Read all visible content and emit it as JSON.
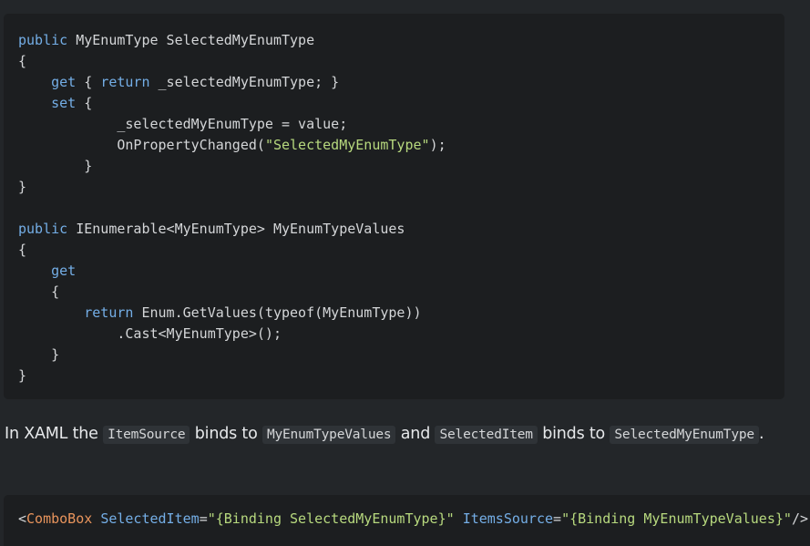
{
  "code1": {
    "lines": [
      [
        {
          "t": "public",
          "c": "kw"
        },
        {
          "t": " MyEnumType SelectedMyEnumType"
        }
      ],
      [
        {
          "t": "{"
        }
      ],
      [
        {
          "t": "    "
        },
        {
          "t": "get",
          "c": "kw"
        },
        {
          "t": " { "
        },
        {
          "t": "return",
          "c": "kw"
        },
        {
          "t": " _selectedMyEnumType; }"
        }
      ],
      [
        {
          "t": "    "
        },
        {
          "t": "set",
          "c": "kw"
        },
        {
          "t": " {"
        }
      ],
      [
        {
          "t": "            _selectedMyEnumType = value;"
        }
      ],
      [
        {
          "t": "            OnPropertyChanged("
        },
        {
          "t": "\"SelectedMyEnumType\"",
          "c": "str"
        },
        {
          "t": ");"
        }
      ],
      [
        {
          "t": "        }"
        }
      ],
      [
        {
          "t": "}"
        }
      ],
      [
        {
          "t": ""
        }
      ],
      [
        {
          "t": "public",
          "c": "kw"
        },
        {
          "t": " IEnumerable<MyEnumType> MyEnumTypeValues"
        }
      ],
      [
        {
          "t": "{"
        }
      ],
      [
        {
          "t": "    "
        },
        {
          "t": "get",
          "c": "kw"
        }
      ],
      [
        {
          "t": "    {"
        }
      ],
      [
        {
          "t": "        "
        },
        {
          "t": "return",
          "c": "kw"
        },
        {
          "t": " Enum.GetValues(typeof(MyEnumType))"
        }
      ],
      [
        {
          "t": "            .Cast<MyEnumType>();"
        }
      ],
      [
        {
          "t": "    }"
        }
      ],
      [
        {
          "t": "}"
        }
      ]
    ]
  },
  "paragraph": {
    "segments": [
      {
        "t": "In XAML the "
      },
      {
        "t": "ItemSource",
        "code": true
      },
      {
        "t": " binds to "
      },
      {
        "t": "MyEnumTypeValues",
        "code": true
      },
      {
        "t": " and "
      },
      {
        "t": "SelectedItem",
        "code": true
      },
      {
        "t": " binds to "
      },
      {
        "t": "SelectedMyEnumType",
        "code": true
      },
      {
        "t": "."
      }
    ]
  },
  "code2": {
    "lines": [
      [
        {
          "t": "<"
        },
        {
          "t": "ComboBox",
          "c": "tag"
        },
        {
          "t": " "
        },
        {
          "t": "SelectedItem",
          "c": "attr"
        },
        {
          "t": "="
        },
        {
          "t": "\"{Binding SelectedMyEnumType}\"",
          "c": "str"
        },
        {
          "t": " "
        },
        {
          "t": "ItemsSource",
          "c": "attr"
        },
        {
          "t": "="
        },
        {
          "t": "\"{Binding MyEnumTypeValues}\"",
          "c": "str"
        },
        {
          "t": "/>"
        }
      ]
    ]
  }
}
